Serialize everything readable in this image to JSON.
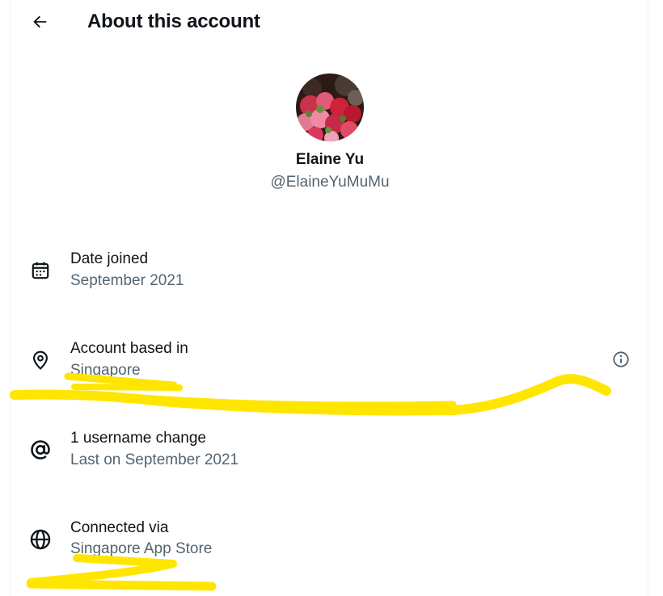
{
  "header": {
    "title": "About this account",
    "back_icon": "arrow-left-icon"
  },
  "profile": {
    "name": "Elaine Yu",
    "handle": "@ElaineYuMuMu"
  },
  "details": [
    {
      "icon": "calendar-icon",
      "label": "Date joined",
      "value": "September 2021"
    },
    {
      "icon": "location-pin-icon",
      "label": "Account based in",
      "value": "Singapore"
    },
    {
      "icon": "at-sign-icon",
      "label": "1 username change",
      "value": "Last on September 2021"
    },
    {
      "icon": "globe-icon",
      "label": "Connected via",
      "value": "Singapore App Store"
    }
  ],
  "colors": {
    "text_primary": "#0f1419",
    "text_secondary": "#536471",
    "border": "#eff3f4",
    "highlighter_scribble": "#ffe600"
  }
}
